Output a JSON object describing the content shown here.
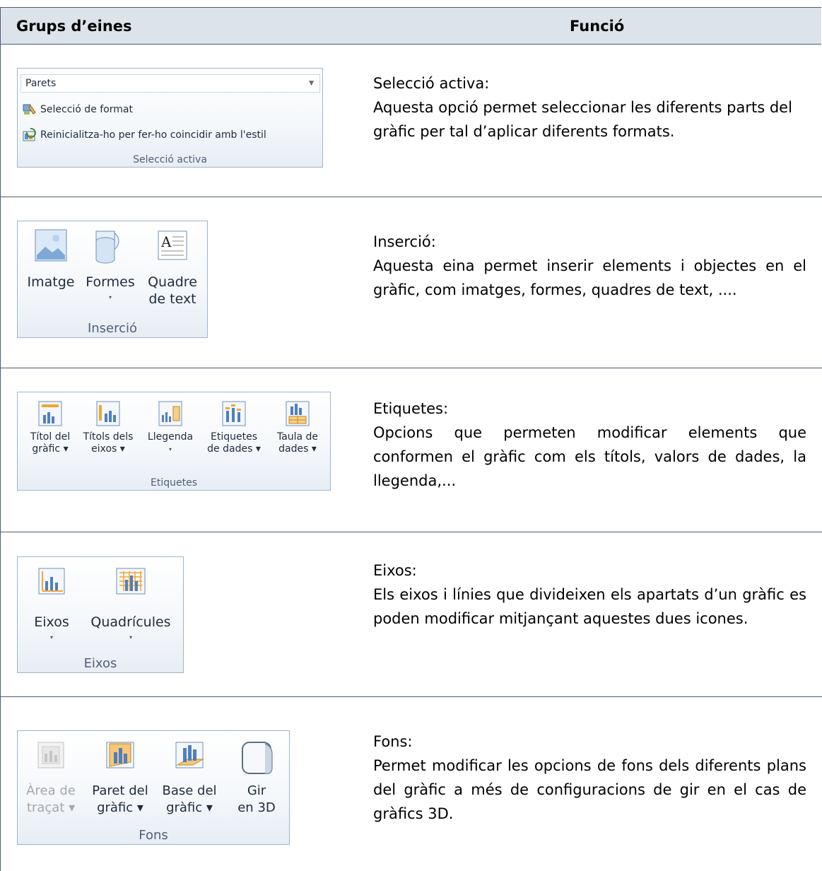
{
  "header": {
    "col1": "Grups d’eines",
    "col2": "Funció"
  },
  "rows": [
    {
      "title": "Selecció activa:",
      "body": "Aquesta opció permet seleccionar les diferents parts del gràfic per tal d’aplicar diferents formats.",
      "group": {
        "combo_value": "Parets",
        "commands": [
          "Selecció de format",
          "Reinicialitza-ho per fer-ho coincidir amb l'estil"
        ],
        "label": "Selecció activa"
      }
    },
    {
      "title": "Inserció:",
      "body": "Aquesta eina permet inserir elements i objectes en el gràfic, com imatges, formes, quadres de text, ....",
      "group": {
        "buttons": [
          {
            "line1": "Imatge",
            "line2": ""
          },
          {
            "line1": "Formes",
            "line2": "▾"
          },
          {
            "line1": "Quadre",
            "line2": "de text"
          }
        ],
        "label": "Inserció"
      }
    },
    {
      "title": "Etiquetes:",
      "body": "Opcions que permeten modificar elements que conformen el gràfic com els títols, valors de dades, la llegenda,...",
      "group": {
        "buttons": [
          {
            "line1": "Títol del",
            "line2": "gràfic ▾"
          },
          {
            "line1": "Títols dels",
            "line2": "eixos ▾"
          },
          {
            "line1": "Llegenda",
            "line2": "▾"
          },
          {
            "line1": "Etiquetes",
            "line2": "de dades ▾"
          },
          {
            "line1": "Taula de",
            "line2": "dades ▾"
          }
        ],
        "label": "Etiquetes"
      }
    },
    {
      "title": "Eixos:",
      "body": "Els eixos i línies que divideixen els apartats d’un gràfic es poden modificar mitjançant aquestes dues icones.",
      "group": {
        "buttons": [
          {
            "line1": "Eixos",
            "line2": "▾"
          },
          {
            "line1": "Quadrícules",
            "line2": "▾"
          }
        ],
        "label": "Eixos"
      }
    },
    {
      "title": "Fons:",
      "body": "Permet modificar les opcions de fons dels diferents plans del gràfic a més de configuracions de gir en el cas de gràfics 3D.",
      "group": {
        "buttons": [
          {
            "line1": "Àrea de",
            "line2": "traçat ▾"
          },
          {
            "line1": "Paret del",
            "line2": "gràfic ▾"
          },
          {
            "line1": "Base del",
            "line2": "gràfic ▾"
          },
          {
            "line1": "Gir",
            "line2": "en 3D"
          }
        ],
        "label": "Fons"
      }
    }
  ]
}
